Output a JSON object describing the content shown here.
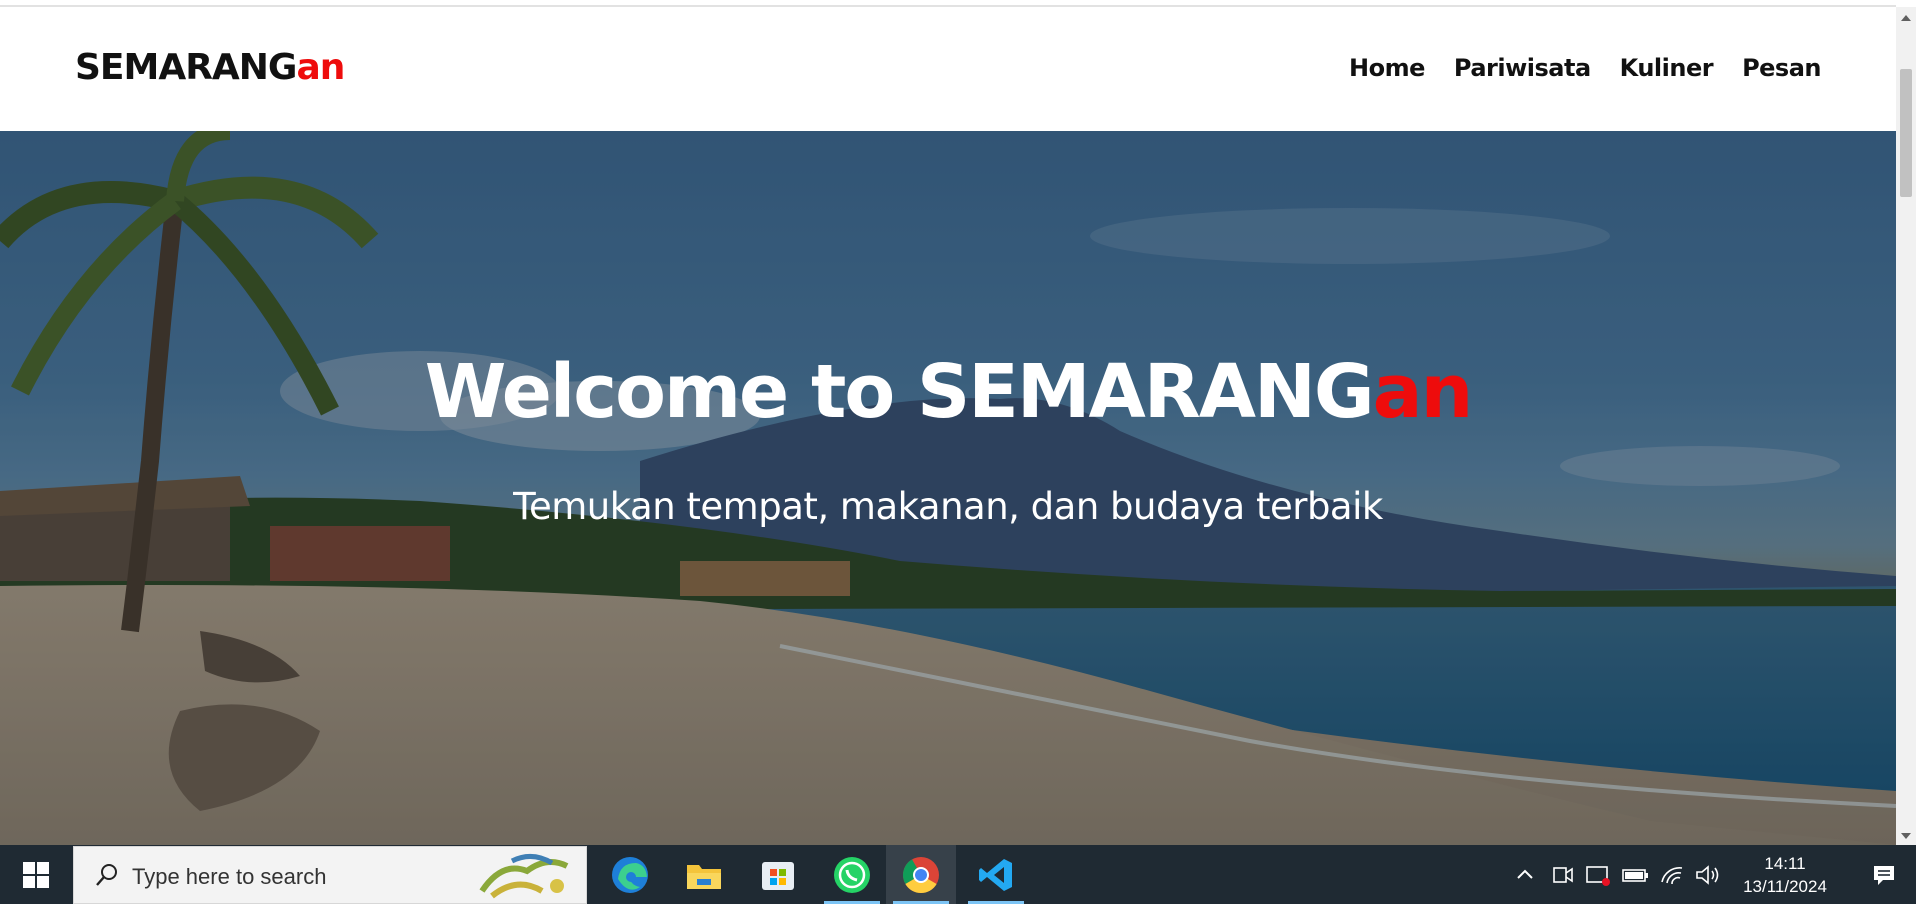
{
  "navbar": {
    "brand_main": "SEMARANG",
    "brand_accent": "an",
    "links": [
      "Home",
      "Pariwisata",
      "Kuliner",
      "Pesan"
    ]
  },
  "hero": {
    "title_main": "Welcome to SEMARANG",
    "title_accent": "an",
    "subtitle": "Temukan tempat, makanan, dan budaya terbaik"
  },
  "taskbar": {
    "search_placeholder": "Type here to search",
    "apps": [
      "start-icon",
      "edge-icon",
      "file-explorer-icon",
      "microsoft-store-icon",
      "whatsapp-icon",
      "chrome-icon",
      "vscode-icon"
    ],
    "time": "14:11",
    "date": "13/11/2024"
  },
  "colors": {
    "accent": "#ee0c0c",
    "text": "#111111",
    "taskbar": "#1f2a33"
  }
}
